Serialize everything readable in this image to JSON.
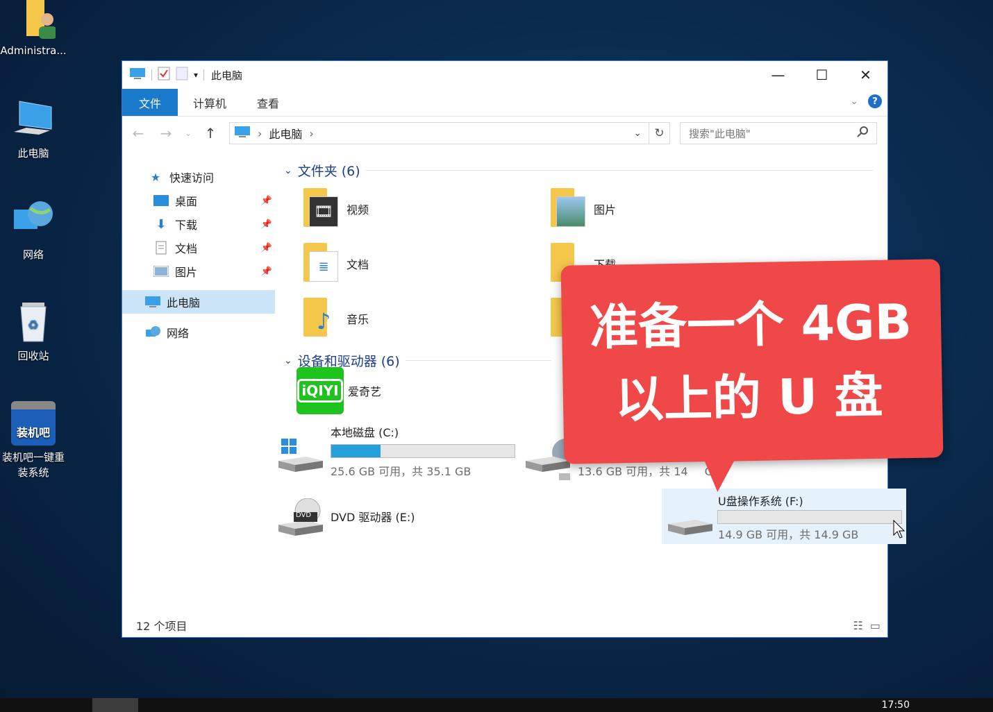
{
  "desktop": {
    "icons": [
      {
        "label": "Administra..."
      },
      {
        "label": "此电脑"
      },
      {
        "label": "网络"
      },
      {
        "label": "回收站"
      },
      {
        "label": "装机吧一键重装系统",
        "line1": "装机吧一键重",
        "line2": "装系统"
      }
    ],
    "zjb_text": "装机吧"
  },
  "window": {
    "title": "此电脑",
    "ribbon": {
      "file": "文件",
      "computer": "计算机",
      "view": "查看"
    },
    "address": {
      "location": "此电脑",
      "search_placeholder": "搜索\"此电脑\""
    },
    "sidebar": {
      "quick_access": "快速访问",
      "desktop": "桌面",
      "downloads": "下载",
      "documents": "文档",
      "pictures": "图片",
      "this_pc": "此电脑",
      "network": "网络"
    },
    "folders_header": "文件夹 (6)",
    "folders": [
      "视频",
      "图片",
      "文档",
      "下载",
      "音乐"
    ],
    "devices_header": "设备和驱动器 (6)",
    "devices": {
      "iqiyi": "爱奇艺",
      "iqiyi_logo": "iQIYI",
      "c_drive": {
        "name": "本地磁盘 (C:)",
        "free": "25.6 GB 可用，共 35.1 GB",
        "used_pct": 27
      },
      "d_free": "13.6 GB 可用，共 14",
      "d_free_tail": "GB",
      "dvd": {
        "name": "DVD 驱动器 (E:)",
        "badge": "DVD"
      },
      "f_drive": {
        "name": "U盘操作系统 (F:)",
        "free": "14.9 GB 可用，共 14.9 GB",
        "used_pct": 0
      }
    },
    "status": "12 个项目"
  },
  "callout": {
    "line1": "准备一个 4GB",
    "line2": "以上的 U 盘"
  },
  "taskbar": {
    "clock": "17:50"
  },
  "colors": {
    "accent": "#1979ca",
    "callout": "#f04848",
    "folder": "#f5c84c",
    "progress": "#26a0da"
  }
}
